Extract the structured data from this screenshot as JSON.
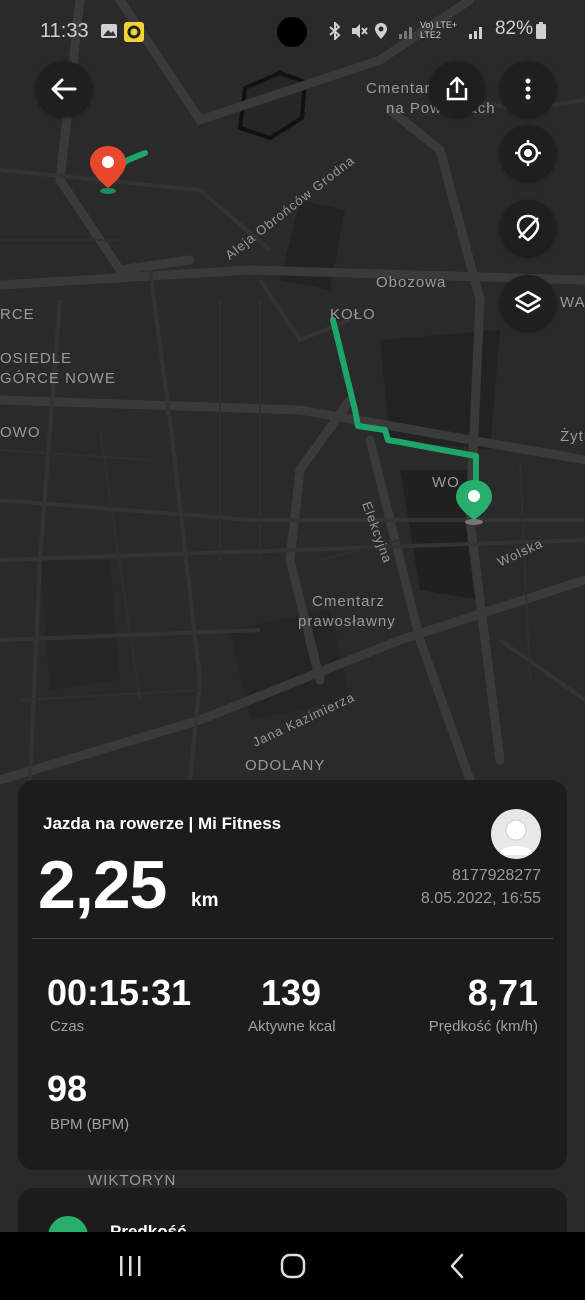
{
  "status_bar": {
    "time": "11:33",
    "network": "Vo) LTE+ LTE2",
    "battery": "82%"
  },
  "map": {
    "labels": {
      "cemetery_top": "Cmentarz",
      "cemetery_top_2": "na Powązkach",
      "street_obroncow": "Aleja Obrońców Grodna",
      "obozowa": "Obozowa",
      "kolo": "KOŁO",
      "osiedle": "OSIEDLE",
      "gorce_nowe": "GÓRCE NOWE",
      "owo": "OWO",
      "rce": "RCE",
      "woa": "WO",
      "elekcyjna": "Elekcyjna",
      "cemetery_orth": "Cmentarz",
      "cemetery_orth_2": "prawosławny",
      "wolska": "Wolska",
      "jana_kazimierza": "Jana Kazimierza",
      "odolany": "ODOLANY",
      "wiktoryn": "WIKTORYN",
      "zytnia": "Żytn",
      "waz": "WAZ"
    },
    "colors": {
      "route": "#1ea56a",
      "start_pin": "#e8492c",
      "end_pin": "#27ae6a"
    }
  },
  "map_controls": {
    "back": "back-icon",
    "share": "share-icon",
    "more": "more-icon",
    "locate": "locate-icon",
    "hide": "hide-route-icon",
    "layers": "layers-icon"
  },
  "workout": {
    "title": "Jazda na rowerze | Mi Fitness",
    "distance": "2,25",
    "distance_unit": "km",
    "user_id": "8177928277",
    "datetime": "8.05.2022, 16:55",
    "stats": [
      {
        "value": "00:15:31",
        "label": "Czas"
      },
      {
        "value": "139",
        "label": "Aktywne kcal"
      },
      {
        "value": "8,71",
        "label": "Prędkość (km/h)"
      },
      {
        "value": "98",
        "label": "BPM (BPM)"
      }
    ]
  },
  "next_card": {
    "label": "Prędkość"
  }
}
